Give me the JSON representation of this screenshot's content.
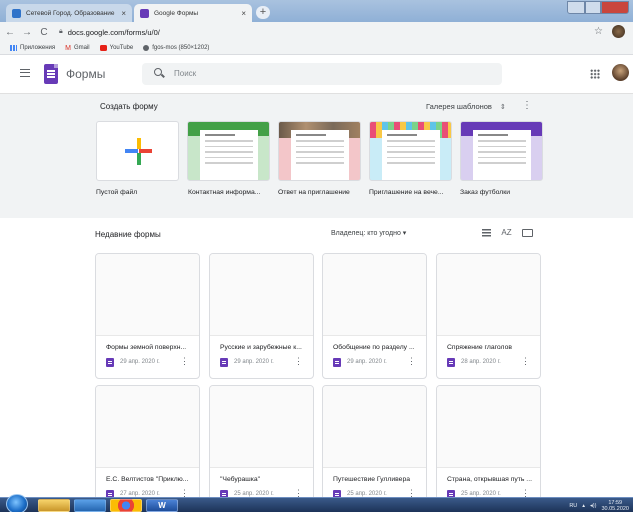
{
  "browser": {
    "tabs": [
      {
        "title": "Сетевой Город. Образование",
        "close": "×"
      },
      {
        "title": "Google Формы",
        "close": "×"
      }
    ],
    "new_tab": "+",
    "url": "docs.google.com/forms/u/0/",
    "nav": {
      "back": "←",
      "forward": "→",
      "reload": "C"
    },
    "star": "☆",
    "bookmarks": [
      "Приложения",
      "Gmail",
      "YouTube",
      "fgos-mos (850×1202)"
    ]
  },
  "app": {
    "title": "Формы",
    "search_placeholder": "Поиск"
  },
  "templates": {
    "section_title": "Создать форму",
    "gallery_label": "Галерея шаблонов",
    "gallery_toggle": "⇕",
    "more": "⋮",
    "items": [
      {
        "label": "Пустой файл",
        "color": "#ffffff"
      },
      {
        "label": "Контактная информа...",
        "color": "#43a047"
      },
      {
        "label": "Ответ на приглашение",
        "color": "#e8aeb2"
      },
      {
        "label": "Приглашение на вече...",
        "color": "#7ec8e3"
      },
      {
        "label": "Заказ футболки",
        "color": "#673ab7"
      }
    ]
  },
  "recent": {
    "section_title": "Недавние формы",
    "owner_filter": "Владелец: кто угодно ▾",
    "sort_icon": "AZ",
    "forms": [
      {
        "title": "Формы земной поверхн...",
        "date": "29 апр. 2020 г."
      },
      {
        "title": "Русские и зарубежные к...",
        "date": "29 апр. 2020 г."
      },
      {
        "title": "Обобщение по разделу ...",
        "date": "29 апр. 2020 г."
      },
      {
        "title": "Спряжение глаголов",
        "date": "28 апр. 2020 г."
      },
      {
        "title": "Е.С. Велтистов \"Приклю...",
        "date": "27 апр. 2020 г."
      },
      {
        "title": "\"Чебурашка\"",
        "date": "25 апр. 2020 г."
      },
      {
        "title": "Путешествие Гулливера",
        "date": "25 апр. 2020 г."
      },
      {
        "title": "Страна, открывшая путь ...",
        "date": "25 апр. 2020 г."
      }
    ],
    "card_menu": "⋮"
  },
  "taskbar": {
    "word_label": "W",
    "lang": "RU",
    "time": "17:59",
    "date": "30.05.2020"
  },
  "colors": {
    "forms_purple": "#673ab7",
    "templates_bg": "#f1f3f4"
  }
}
